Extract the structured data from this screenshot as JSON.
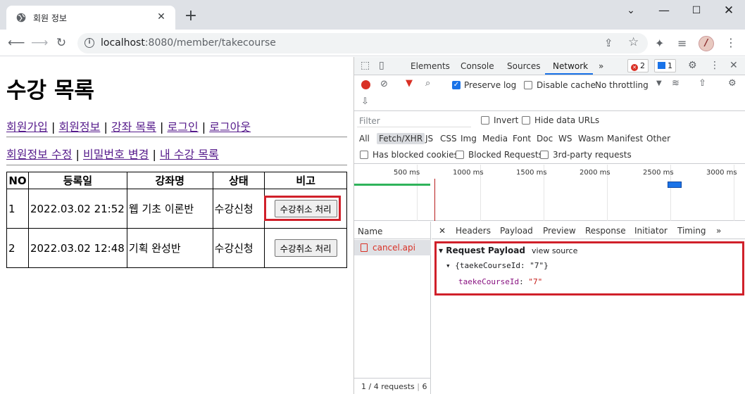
{
  "browser": {
    "tab_title": "회원 정보",
    "tab_close": "✕",
    "new_tab": "+",
    "window_controls": {
      "dropdown": "⌄",
      "minimize": "—",
      "maximize": "☐",
      "close": "✕"
    },
    "url_host": "localhost",
    "url_path": ":8080/member/takecourse",
    "icons": [
      "back-arrow-icon",
      "forward-arrow-icon",
      "reload-icon",
      "info-icon",
      "share-icon",
      "star-icon",
      "puzzle-icon",
      "media-list-icon",
      "avatar",
      "menu-icon"
    ]
  },
  "page": {
    "title": "수강 목록",
    "nav1": [
      {
        "label": "회원가입"
      },
      {
        "label": "회원정보"
      },
      {
        "label": "강좌 목록"
      },
      {
        "label": "로그인"
      },
      {
        "label": "로그아웃"
      }
    ],
    "nav2": [
      {
        "label": "회원정보 수정"
      },
      {
        "label": "비밀번호 변경"
      },
      {
        "label": "내 수강 목록"
      }
    ],
    "separator": "|",
    "table": {
      "headers": [
        "NO",
        "등록일",
        "강좌명",
        "상태",
        "비고"
      ],
      "rows": [
        {
          "no": "1",
          "date": "2022.03.02 21:52",
          "course": "웹 기초 이론반",
          "status": "수강신청",
          "action": "수강취소 처리"
        },
        {
          "no": "2",
          "date": "2022.03.02 12:48",
          "course": "기획 완성반",
          "status": "수강신청",
          "action": "수강취소 처리"
        }
      ]
    }
  },
  "devtools": {
    "tabs": [
      "Elements",
      "Console",
      "Sources",
      "Network"
    ],
    "more": "»",
    "active_tab": "Network",
    "errors_count": "2",
    "messages_count": "1",
    "toolbar": {
      "preserve_log": "Preserve log",
      "preserve_log_checked": true,
      "disable_cache": "Disable cache",
      "throttling": "No throttling"
    },
    "filter_placeholder": "Filter",
    "invert": "Invert",
    "hide_data_urls": "Hide data URLs",
    "types": [
      "All",
      "Fetch/XHR",
      "JS",
      "CSS",
      "Img",
      "Media",
      "Font",
      "Doc",
      "WS",
      "Wasm",
      "Manifest",
      "Other"
    ],
    "selected_type": "Fetch/XHR",
    "has_blocked_cookies": "Has blocked cookies",
    "blocked_requests": "Blocked Requests",
    "third_party": "3rd-party requests",
    "timeline_ticks": [
      "500 ms",
      "1000 ms",
      "1500 ms",
      "2000 ms",
      "2500 ms",
      "3000 ms"
    ],
    "name_header": "Name",
    "request_name": "cancel.api",
    "status_bar": "1 / 4 requests",
    "status_extra": "6",
    "detail_tabs": [
      "Headers",
      "Payload",
      "Preview",
      "Response",
      "Initiator",
      "Timing"
    ],
    "detail_close": "✕",
    "payload": {
      "title": "Request Payload",
      "view_source": "view source",
      "object_summary": "{taekeCourseId: \"7\"}",
      "key": "taekeCourseId",
      "value": "\"7\""
    }
  }
}
